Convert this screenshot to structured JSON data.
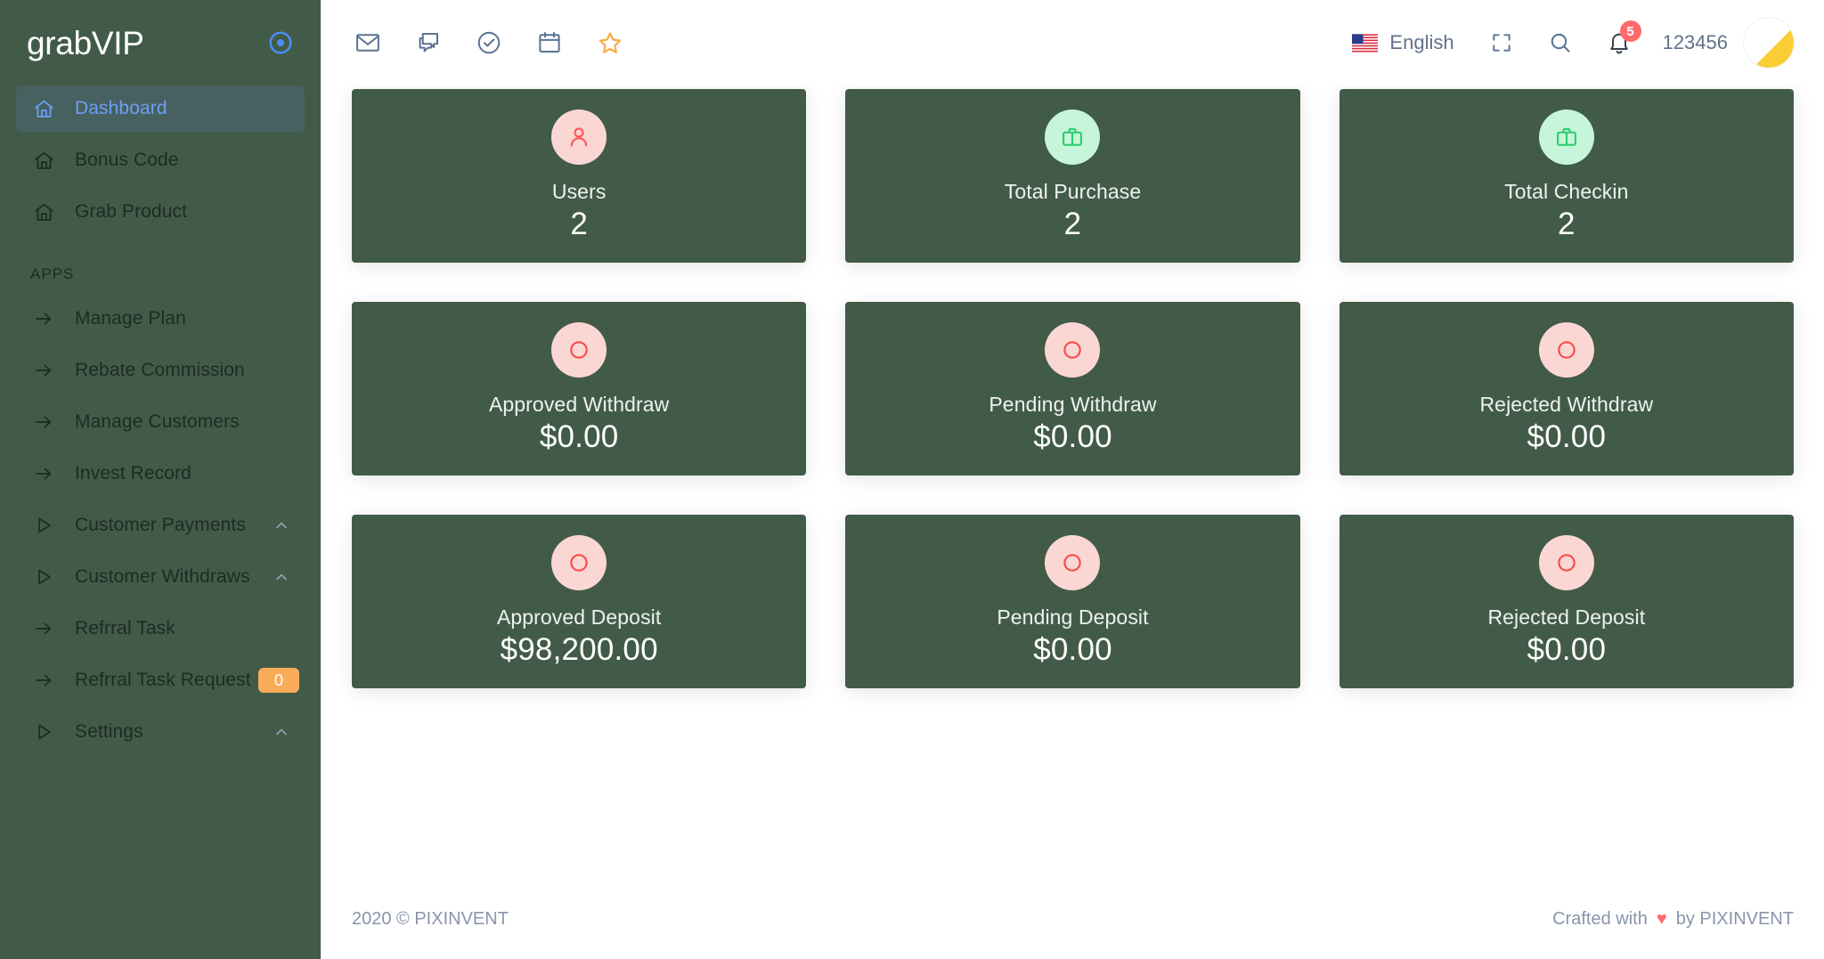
{
  "sidebar": {
    "brand": "grabVIP",
    "brand_icon": "target-circle-icon",
    "items": [
      {
        "label": "Dashboard",
        "icon": "home-icon",
        "active": true
      },
      {
        "label": "Bonus Code",
        "icon": "home-icon",
        "active": false
      },
      {
        "label": "Grab Product",
        "icon": "home-icon",
        "active": false
      }
    ],
    "section_title": "APPS",
    "app_items": [
      {
        "label": "Manage Plan",
        "icon": "arrow-right-icon",
        "chevron": false,
        "badge": null
      },
      {
        "label": "Rebate Commission",
        "icon": "arrow-right-icon",
        "chevron": false,
        "badge": null
      },
      {
        "label": "Manage Customers",
        "icon": "arrow-right-icon",
        "chevron": false,
        "badge": null
      },
      {
        "label": "Invest Record",
        "icon": "arrow-right-icon",
        "chevron": false,
        "badge": null
      },
      {
        "label": "Customer Payments",
        "icon": "play-triangle-icon",
        "chevron": true,
        "badge": null
      },
      {
        "label": "Customer Withdraws",
        "icon": "play-triangle-icon",
        "chevron": true,
        "badge": null
      },
      {
        "label": "Refrral Task",
        "icon": "arrow-right-icon",
        "chevron": false,
        "badge": null
      },
      {
        "label": "Refrral Task Request",
        "icon": "arrow-right-icon",
        "chevron": false,
        "badge": "0"
      },
      {
        "label": "Settings",
        "icon": "play-triangle-icon",
        "chevron": true,
        "badge": null
      }
    ]
  },
  "topbar": {
    "left_icons": [
      {
        "name": "mail-icon"
      },
      {
        "name": "chat-icon"
      },
      {
        "name": "check-circle-icon"
      },
      {
        "name": "calendar-icon"
      },
      {
        "name": "star-icon"
      }
    ],
    "language": "English",
    "flag_icon": "us-flag-icon",
    "fullscreen_icon": "fullscreen-icon",
    "search_icon": "search-icon",
    "bell_icon": "bell-icon",
    "notification_count": "5",
    "username": "123456",
    "avatar_icon": "check-avatar-icon"
  },
  "cards": [
    {
      "title": "Users",
      "value": "2",
      "icon": "user-icon",
      "icon_color": "#ff5b5b",
      "circle_color": "#fbd7d4"
    },
    {
      "title": "Total Purchase",
      "value": "2",
      "icon": "briefcase-icon",
      "icon_color": "#2ecc71",
      "circle_color": "#c7f5d9"
    },
    {
      "title": "Total Checkin",
      "value": "2",
      "icon": "briefcase-icon",
      "icon_color": "#2ecc71",
      "circle_color": "#c7f5d9"
    },
    {
      "title": "Approved Withdraw",
      "value": "$0.00",
      "icon": "circle-outline-icon",
      "icon_color": "#fa4b4b",
      "circle_color": "#fbd7d4"
    },
    {
      "title": "Pending Withdraw",
      "value": "$0.00",
      "icon": "circle-outline-icon",
      "icon_color": "#fa4b4b",
      "circle_color": "#fbd7d4"
    },
    {
      "title": "Rejected Withdraw",
      "value": "$0.00",
      "icon": "circle-outline-icon",
      "icon_color": "#fa4b4b",
      "circle_color": "#fbd7d4"
    },
    {
      "title": "Approved Deposit",
      "value": "$98,200.00",
      "icon": "circle-outline-icon",
      "icon_color": "#fa4b4b",
      "circle_color": "#fbd7d4"
    },
    {
      "title": "Pending Deposit",
      "value": "$0.00",
      "icon": "circle-outline-icon",
      "icon_color": "#fa4b4b",
      "circle_color": "#fbd7d4"
    },
    {
      "title": "Rejected Deposit",
      "value": "$0.00",
      "icon": "circle-outline-icon",
      "icon_color": "#fa4b4b",
      "circle_color": "#fbd7d4"
    }
  ],
  "footer": {
    "left": "2020 © PIXINVENT",
    "right_prefix": "Crafted with",
    "heart": "♥",
    "right_suffix": "by PIXINVENT"
  },
  "colors": {
    "sidebar_bg": "#425b49",
    "card_bg": "#425b49",
    "active_item_bg": "#466160",
    "active_item_text": "#6f9ef5",
    "badge_orange": "#f8ac59",
    "badge_red": "#ff6b6b",
    "accent_yellow": "#fbcc34",
    "topbar_icon": "#5b7394",
    "star_orange": "#f9ab44",
    "footer_text": "#8a95ab"
  }
}
